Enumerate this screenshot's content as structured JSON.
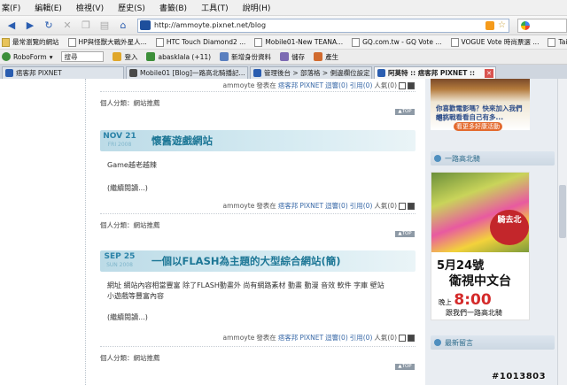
{
  "menubar": {
    "items": [
      "案(F)",
      "編輯(E)",
      "檢視(V)",
      "歷史(S)",
      "書籤(B)",
      "工具(T)",
      "說明(H)"
    ]
  },
  "nav": {
    "url": "http://ammoyte.pixnet.net/blog"
  },
  "bookmarks": [
    {
      "label": "最常瀏覽的網站",
      "icon": "folder-icon"
    },
    {
      "label": "HP與怪獸大戰外星人...",
      "icon": "page-icon"
    },
    {
      "label": "HTC Touch Diamond2 ...",
      "icon": "page-icon"
    },
    {
      "label": "Mobile01-New TEANA...",
      "icon": "page-icon"
    },
    {
      "label": "GQ.com.tw - GQ Vote ...",
      "icon": "page-icon"
    },
    {
      "label": "VOGUE Vote 時尚票選 ...",
      "icon": "page-icon"
    },
    {
      "label": "Taipei Walker CINEM...",
      "icon": "page-icon"
    }
  ],
  "toolbar": {
    "roboform": "RoboForm",
    "search_label": "搜尋",
    "login": "登入",
    "user": "abasklala (+11)",
    "new_id": "新增身份資料",
    "save": "儲存",
    "generate": "產生"
  },
  "tabs": [
    {
      "label": "痞客邦 PIXNET",
      "active": false
    },
    {
      "label": "Mobile01 [Blog]一路高北騎播記...",
      "active": false
    },
    {
      "label": "管理後台 > 部落格 > 側邊欄位設定",
      "active": false
    },
    {
      "label": "阿莫特 :: 痞客邦 PIXNET ::",
      "active": true
    }
  ],
  "posts": {
    "top_meta": {
      "author": "ammoyte",
      "published": "發表在",
      "site": "痞客邦",
      "pixnet": "PIXNET",
      "comments": "迴響(0)",
      "trackback": "引用(0)",
      "popularity": "人氣(0)"
    },
    "top_category": "個人分類：網站推薦",
    "totop": "▲TOP",
    "list": [
      {
        "date_main": "NOV 21",
        "date_sub": "FRI 2008",
        "title": "懷舊遊戲網站",
        "body": "Game越老越辣",
        "more": "(繼續閱讀...)",
        "meta": {
          "author": "ammoyte",
          "published": "發表在",
          "site": "痞客邦",
          "pixnet": "PIXNET",
          "comments": "迴響(0)",
          "trackback": "引用(0)",
          "popularity": "人氣(0)"
        },
        "category": "個人分類：網站推薦"
      },
      {
        "date_main": "SEP 25",
        "date_sub": "SUN 2008",
        "title": "一個以FLASH為主題的大型綜合網站(簡)",
        "body_line1": "網址 網站內容相當豐富 除了FLASH動畫外 尚有網路素材 動畫 動漫 音效 軟件 字庫 壁站",
        "body_line2": "小遊戲等豐富內容",
        "more": "(繼續閱讀...)",
        "meta": {
          "author": "ammoyte",
          "published": "發表在",
          "site": "痞客邦",
          "pixnet": "PIXNET",
          "comments": "迴響(0)",
          "trackback": "引用(0)",
          "popularity": "人氣(0)"
        },
        "category": "個人分類：網站推薦"
      }
    ]
  },
  "sidebar": {
    "ad1": {
      "line1": "你喜歡電影嗎？快來加入我們吧！",
      "line2": "想挑戰看看自己有多...",
      "cta": "看更多好康活動"
    },
    "widget1": "一路高北騎",
    "ad2": {
      "badge": "騎去北",
      "date": "5月24號",
      "channel": "衛視中文台",
      "time_prefix": "晚上",
      "time": "8:00",
      "tagline": "跟我們一路高北騎"
    },
    "widget2": "最新留言"
  },
  "watermark": "#1013803",
  "colors": {
    "accent": "#1d7796",
    "header_band": "#bcdbe7",
    "sidebar_bg": "#e9edf2"
  }
}
